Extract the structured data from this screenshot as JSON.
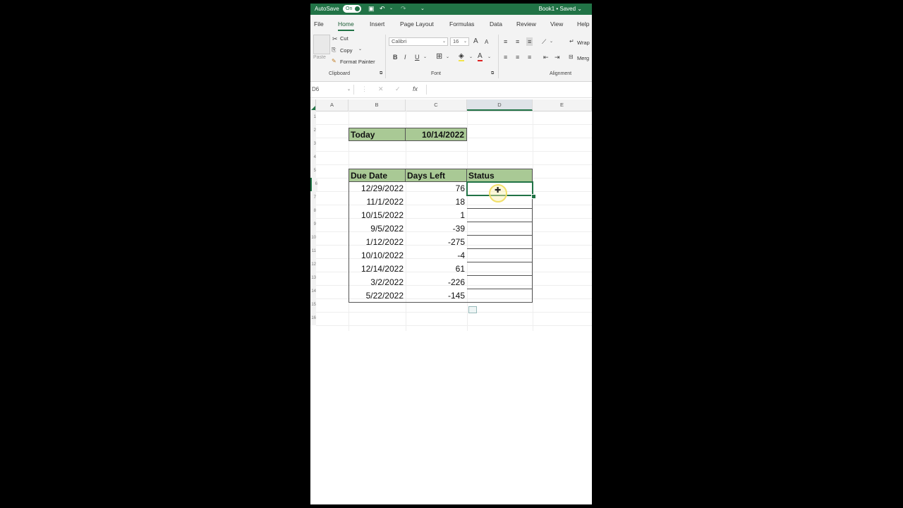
{
  "titlebar": {
    "autosave_label": "AutoSave",
    "toggle_label": "On",
    "doc_title": "Book1 • Saved ⌄"
  },
  "tabs": [
    "File",
    "Home",
    "Insert",
    "Page Layout",
    "Formulas",
    "Data",
    "Review",
    "View",
    "Help"
  ],
  "ribbon": {
    "clipboard": {
      "cut": "Cut",
      "copy": "Copy",
      "format_painter": "Format Painter",
      "paste": "Paste",
      "label": "Clipboard"
    },
    "font": {
      "name": "Calibri",
      "size": "16",
      "label": "Font"
    },
    "alignment": {
      "wrap": "Wrap",
      "merge": "Merg",
      "label": "Alignment"
    }
  },
  "formula_bar": {
    "name_box": "D6",
    "fx": "fx",
    "value": ""
  },
  "columns": [
    "A",
    "B",
    "C",
    "D",
    "E"
  ],
  "rows": [
    "1",
    "2",
    "3",
    "4",
    "5",
    "6",
    "7",
    "8",
    "9",
    "10",
    "11",
    "12",
    "13",
    "14",
    "15",
    "16"
  ],
  "today": {
    "label": "Today",
    "value": "10/14/2022"
  },
  "table": {
    "headers": [
      "Due Date",
      "Days Left",
      "Status"
    ],
    "rows": [
      {
        "due": "12/29/2022",
        "days": "76"
      },
      {
        "due": "11/1/2022",
        "days": "18"
      },
      {
        "due": "10/15/2022",
        "days": "1"
      },
      {
        "due": "9/5/2022",
        "days": "-39"
      },
      {
        "due": "1/12/2022",
        "days": "-275"
      },
      {
        "due": "10/10/2022",
        "days": "-4"
      },
      {
        "due": "12/14/2022",
        "days": "61"
      },
      {
        "due": "3/2/2022",
        "days": "-226"
      },
      {
        "due": "5/22/2022",
        "days": "-145"
      }
    ]
  },
  "colors": {
    "excel_green": "#217346",
    "header_fill": "#a9c995"
  }
}
